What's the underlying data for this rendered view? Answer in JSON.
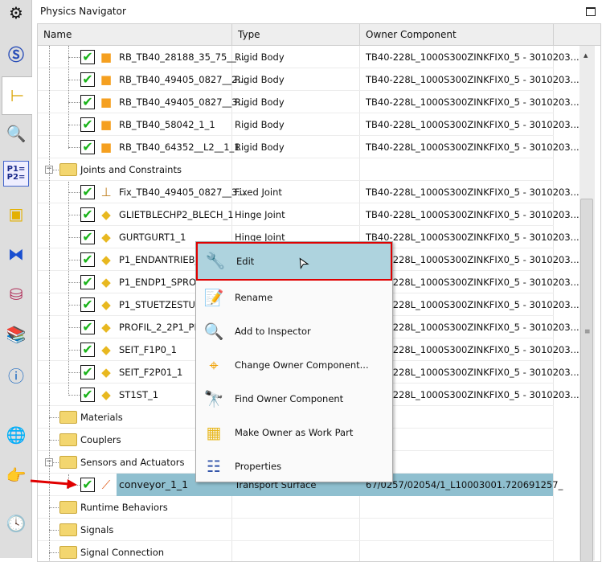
{
  "toolbar": {
    "icons": [
      "gear-icon",
      "simulation-sequence-icon",
      "physics-navigator-icon",
      "inspector-icon",
      "parameters-icon",
      "assembly-icon",
      "constraints-icon",
      "database-icon",
      "library-icon",
      "info-icon",
      "web-page-icon",
      "pointing-hand-icon",
      "clock-icon"
    ]
  },
  "panel": {
    "title": "Physics Navigator"
  },
  "columns": {
    "name": "Name",
    "type": "Type",
    "owner": "Owner Component"
  },
  "rows": [
    {
      "name": "RB_TB40_28188_35_75__...",
      "type": "Rigid Body",
      "owner": "TB40-228L_1000S300ZINKFIX0_5 - 3010203..."
    },
    {
      "name": "RB_TB40_49405_0827__2...",
      "type": "Rigid Body",
      "owner": "TB40-228L_1000S300ZINKFIX0_5 - 3010203..."
    },
    {
      "name": "RB_TB40_49405_0827__3...",
      "type": "Rigid Body",
      "owner": "TB40-228L_1000S300ZINKFIX0_5 - 3010203..."
    },
    {
      "name": "RB_TB40_58042_1_1",
      "type": "Rigid Body",
      "owner": "TB40-228L_1000S300ZINKFIX0_5 - 3010203..."
    },
    {
      "name": "RB_TB40_64352__L2__1_1",
      "type": "Rigid Body",
      "owner": "TB40-228L_1000S300ZINKFIX0_5 - 3010203..."
    },
    {
      "name": "Joints and Constraints",
      "type": "",
      "owner": ""
    },
    {
      "name": "Fix_TB40_49405_0827__3...",
      "type": "Fixed Joint",
      "owner": "TB40-228L_1000S300ZINKFIX0_5 - 3010203..."
    },
    {
      "name": "GLIETBLECHP2_BLECH_1",
      "type": "Hinge Joint",
      "owner": "TB40-228L_1000S300ZINKFIX0_5 - 3010203..."
    },
    {
      "name": "GURTGURT1_1",
      "type": "Hinge Joint",
      "owner": "TB40-228L_1000S300ZINKFIX0_5 - 3010203..."
    },
    {
      "name": "P1_ENDANTRIEB_",
      "type": "",
      "owner": "TB40-228L_1000S300ZINKFIX0_5 - 3010203..."
    },
    {
      "name": "P1_ENDP1_SPROF",
      "type": "",
      "owner": "TB40-228L_1000S300ZINKFIX0_5 - 3010203..."
    },
    {
      "name": "P1_STUETZESTUET",
      "type": "",
      "owner": "TB40-228L_1000S300ZINKFIX0_5 - 3010203..."
    },
    {
      "name": "PROFIL_2_2P1_PRO",
      "type": "",
      "owner": "TB40-228L_1000S300ZINKFIX0_5 - 3010203..."
    },
    {
      "name": "SEIT_F1P0_1",
      "type": "",
      "owner": "TB40-228L_1000S300ZINKFIX0_5 - 3010203..."
    },
    {
      "name": "SEIT_F2P01_1",
      "type": "",
      "owner": "TB40-228L_1000S300ZINKFIX0_5 - 3010203..."
    },
    {
      "name": "ST1ST_1",
      "type": "",
      "owner": "TB40-228L_1000S300ZINKFIX0_5 - 3010203..."
    },
    {
      "name": "Materials",
      "type": "",
      "owner": ""
    },
    {
      "name": "Couplers",
      "type": "",
      "owner": ""
    },
    {
      "name": "Sensors and Actuators",
      "type": "",
      "owner": ""
    },
    {
      "name": "conveyor_1_1",
      "type": "Transport Surface",
      "owner": "67/0257/02054/1_L10003001.720691257_"
    },
    {
      "name": "Runtime Behaviors",
      "type": "",
      "owner": ""
    },
    {
      "name": "Signals",
      "type": "",
      "owner": ""
    },
    {
      "name": "Signal Connection",
      "type": "",
      "owner": ""
    }
  ],
  "context_menu": {
    "items": [
      {
        "label": "Edit",
        "icon": "wrench-icon"
      },
      {
        "label": "Rename",
        "icon": "rename-icon"
      },
      {
        "label": "Add to Inspector",
        "icon": "inspector-icon"
      },
      {
        "label": "Change Owner Component...",
        "icon": "change-owner-icon"
      },
      {
        "label": "Find Owner Component",
        "icon": "binoculars-icon"
      },
      {
        "label": "Make Owner as Work Part",
        "icon": "work-part-icon"
      },
      {
        "label": "Properties",
        "icon": "properties-icon"
      }
    ]
  },
  "colors": {
    "selection": "#8fbfcf",
    "menu_hover": "#aed3de",
    "highlight_border": "#e00000",
    "check": "#19b319"
  }
}
